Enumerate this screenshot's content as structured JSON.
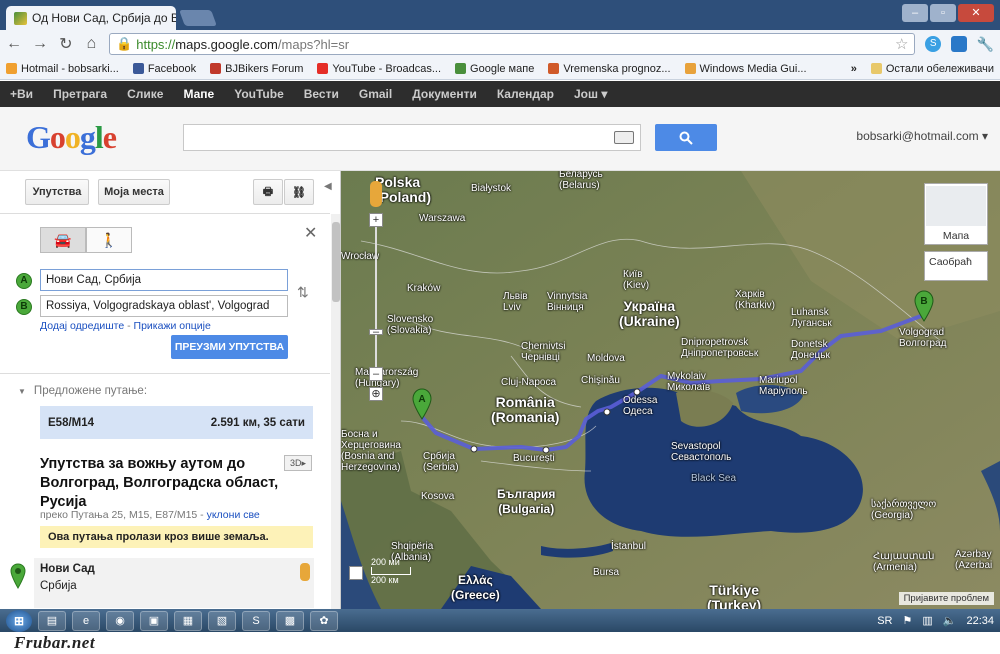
{
  "browser": {
    "tab_title": "Од Нови Сад, Србија до В",
    "url_https": "https://",
    "url_host": "maps.google.com",
    "url_rest": "/maps?hl=sr",
    "bookmarks": [
      "Hotmail - bobsarki...",
      "Facebook",
      "BJBikers Forum",
      "YouTube - Broadcas...",
      "Google мапе",
      "Vremenska prognoz...",
      "Windows Media Gui..."
    ],
    "bookmarks_more": "»",
    "bookmarks_folder": "Остали обележивачи"
  },
  "gbar": {
    "items": [
      "+Ви",
      "Претрага",
      "Слике",
      "Мапе",
      "YouTube",
      "Вести",
      "Gmail",
      "Документи",
      "Календар",
      "Још ▾"
    ]
  },
  "header": {
    "logo_g1": "G",
    "logo_o1": "o",
    "logo_o2": "o",
    "logo_g2": "g",
    "logo_l": "l",
    "logo_e": "e",
    "account": "bobsarki@hotmail.com ▾"
  },
  "panel": {
    "btn_directions": "Упутства",
    "btn_myplaces": "Моја места",
    "point_a_label": "A",
    "point_b_label": "B",
    "point_a_value": "Нови Сад, Србија",
    "point_b_value": "Rossiya, Volgogradskaya oblast', Volgograd",
    "add_destination": "Додај одредиште",
    "show_options": "Прикажи опције",
    "get_directions": "ПРЕУЗМИ УПУТСТВА",
    "suggested_routes": "Предложене путање:",
    "route_name": "E58/M14",
    "route_distance": "2.591 км, 35 сати",
    "directions_title": "Упутства за вожњу аутом до Волгоград, Волгоградска област, Русија",
    "btn_3d": "3D▸",
    "via_text": "преко Путања 25, M15, E87/M15 -",
    "remove_all": "уклони све",
    "warning": "Ова путања пролази кроз више земаља.",
    "start_city": "Нови Сад",
    "start_country": "Србија"
  },
  "map": {
    "btn_map": "Мапа",
    "btn_traffic": "Саобраћ",
    "report_problem": "Пријавите проблем",
    "scale_miles": "200 ми",
    "scale_km": "200 км",
    "labels": {
      "poland": "Polska\n(Poland)",
      "bialystok": "Białystok",
      "belarus": "Беларусь\n(Belarus)",
      "warszawa": "Warszawa",
      "krakow": "Kraków",
      "wroclaw": "Wrocław",
      "slovensko": "Slovensko\n(Slovakia)",
      "ukraine": "Україна\n(Ukraine)",
      "kyiv": "Київ\n(Kiev)",
      "lviv": "Львів\nLviv",
      "vinnytsia": "Vinnytsia\nВінниця",
      "kharkiv": "Харків\n(Kharkiv)",
      "luhansk": "Luhansk\nЛуганськ",
      "dnipro": "Dnipropetrovsk\nДніпропетровськ",
      "donetsk": "Donetsk\nДонецьк",
      "volgograd": "Volgograd\nВолгоград",
      "hungary": "Magyarország\n(Hungary)",
      "chernivtsi": "Chernivtsi\nЧернівці",
      "moldova": "Moldova",
      "kishinev": "Chişinău",
      "cluj": "Cluj-Napoca",
      "romania": "România\n(Romania)",
      "odessa": "Odessa\nОдеса",
      "mykolaiv": "Mykolaiv\nМиколаїв",
      "mariupol": "Mariupol\nМаріуполь",
      "bosnia": "Босна и\nХерцеговина\n(Bosnia and\nHerzegovina)",
      "srbija": "Србија\n(Serbia)",
      "bucuresti": "București",
      "sevastopol": "Sevastopol\nСевастополь",
      "black_sea": "Black Sea",
      "bulgaria": "България\n(Bulgaria)",
      "kosova": "Kosova",
      "shqiperia": "Shqipëria\n(Albania)",
      "istanbul": "İstanbul",
      "bursa": "Bursa",
      "ellas": "Ελλάς\n(Greece)",
      "turkiye": "Türkiye\n(Turkey)",
      "georgia": "საქართველო\n(Georgia)",
      "armenia": "Հայաստան\n(Armenia)",
      "azerbaijan": "Azərbay\n(Azerbai"
    }
  },
  "taskbar": {
    "time": "22:34",
    "lang": "SR"
  },
  "watermark": "Frubar.net"
}
